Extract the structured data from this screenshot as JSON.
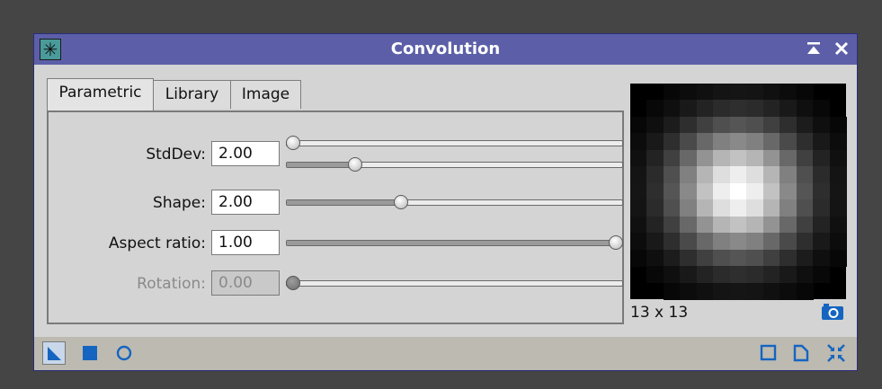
{
  "window": {
    "title": "Convolution",
    "accent_color": "#5c5fa8",
    "icon_color": "#1565c0"
  },
  "titlebar": {
    "app_icon": "asterisk-icon",
    "shade_icon": "shade-up-icon",
    "close_icon": "close-icon"
  },
  "tabs": [
    {
      "label": "Parametric",
      "active": true
    },
    {
      "label": "Library",
      "active": false
    },
    {
      "label": "Image",
      "active": false
    }
  ],
  "params": {
    "stddev": {
      "label": "StdDev:",
      "value": "2.00",
      "slider_coarse_fraction": 0.0,
      "slider_fine_fraction": 0.2
    },
    "shape": {
      "label": "Shape:",
      "value": "2.00",
      "slider_fraction": 0.34
    },
    "aspect": {
      "label": "Aspect ratio:",
      "value": "1.00",
      "slider_fraction": 1.0
    },
    "rotation": {
      "label": "Rotation:",
      "value": "0.00",
      "slider_fraction": 0.0,
      "disabled": true
    }
  },
  "preview": {
    "size_label": "13 x 13",
    "grid": 13,
    "camera_icon": "camera-icon"
  },
  "bottom_bar": {
    "left_icons": [
      "new-instance-icon",
      "apply-global-icon",
      "real-time-preview-icon"
    ],
    "right_icons": [
      "edit-description-icon",
      "browse-documentation-icon",
      "reset-icon"
    ]
  }
}
